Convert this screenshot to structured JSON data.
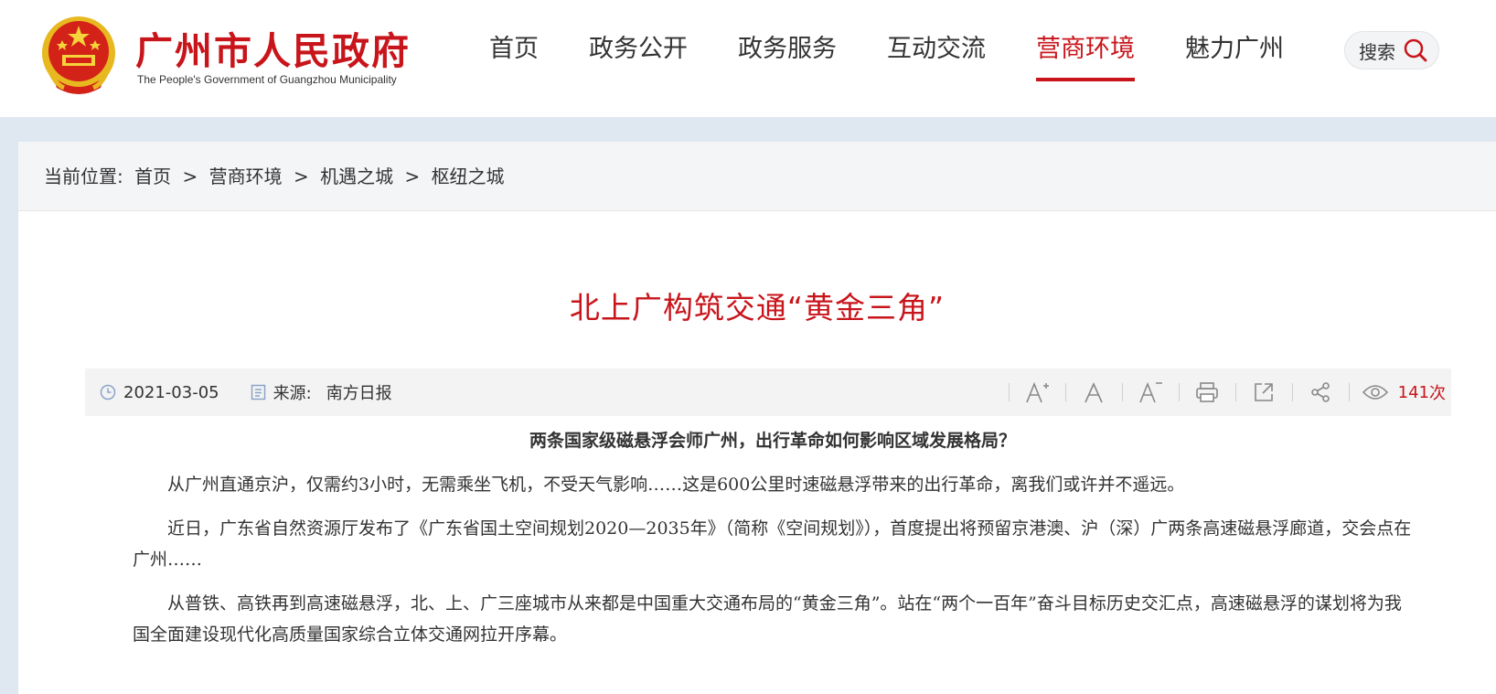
{
  "header": {
    "site_title": "广州市人民政府",
    "site_subtitle": "The People's Government of Guangzhou Municipality",
    "nav": [
      {
        "label": "首页",
        "active": false
      },
      {
        "label": "政务公开",
        "active": false
      },
      {
        "label": "政务服务",
        "active": false
      },
      {
        "label": "互动交流",
        "active": false
      },
      {
        "label": "营商环境",
        "active": true
      },
      {
        "label": "魅力广州",
        "active": false
      }
    ],
    "search_label": "搜索"
  },
  "breadcrumb": {
    "prefix": "当前位置:",
    "items": [
      "首页",
      "营商环境",
      "机遇之城",
      "枢纽之城"
    ],
    "separator": ">"
  },
  "article": {
    "title": "北上广构筑交通“黄金三角”",
    "date": "2021-03-05",
    "source_label": "来源:",
    "source": "南方日报",
    "views": "141",
    "views_unit": "次",
    "subhead": "两条国家级磁悬浮会师广州，出行革命如何影响区域发展格局？",
    "paragraphs": [
      "从广州直通京沪，仅需约3小时，无需乘坐飞机，不受天气影响……这是600公里时速磁悬浮带来的出行革命，离我们或许并不遥远。",
      "近日，广东省自然资源厅发布了《广东省国土空间规划2020—2035年》（简称《空间规划》），首度提出将预留京港澳、沪（深）广两条高速磁悬浮廊道，交会点在广州……",
      "从普铁、高铁再到高速磁悬浮，北、上、广三座城市从来都是中国重大交通布局的“黄金三角”。站在“两个一百年”奋斗目标历史交汇点，高速磁悬浮的谋划将为我国全面建设现代化高质量国家综合立体交通网拉开序幕。"
    ]
  },
  "colors": {
    "accent": "#c8151b",
    "page_bg": "#dfe8f1",
    "meta_bg": "#f3f3f3"
  },
  "icons": [
    "emblem-logo",
    "search-icon",
    "clock-icon",
    "document-icon",
    "font-increase-icon",
    "font-reset-icon",
    "font-decrease-icon",
    "print-icon",
    "share-out-icon",
    "share-icon",
    "eye-icon"
  ]
}
